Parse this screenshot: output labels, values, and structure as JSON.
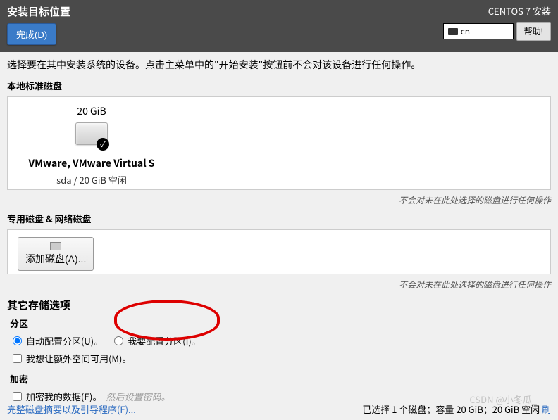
{
  "header": {
    "title": "安装目标位置",
    "done_button": "完成(D)",
    "installer_name": "CENTOS 7 安装",
    "lang": "cn",
    "help_button": "帮助!"
  },
  "instruction": "选择要在其中安装系统的设备。点击主菜单中的\"开始安装\"按钮前不会对该设备进行任何操作。",
  "local_disks": {
    "label": "本地标准磁盘",
    "disk": {
      "size": "20 GiB",
      "name": "VMware, VMware Virtual S",
      "info": "sda    /    20 GiB 空闲"
    },
    "note": "不会对未在此处选择的磁盘进行任何操作"
  },
  "special_disks": {
    "label": "专用磁盘 & 网络磁盘",
    "add_button": "添加磁盘(A)...",
    "note": "不会对未在此处选择的磁盘进行任何操作"
  },
  "other_storage": {
    "title": "其它存储选项",
    "partition": {
      "label": "分区",
      "auto": "自动配置分区(U)。",
      "manual": "我要配置分区(I)。",
      "extra_space": "我想让额外空间可用(M)。"
    },
    "encryption": {
      "label": "加密",
      "encrypt_data": "加密我的数据(E)。",
      "hint": "然后设置密码。"
    }
  },
  "footer": {
    "summary_link": "完整磁盘摘要以及引导程序(F)...",
    "status": "已选择 1 个磁盘；容量 20 GiB；20 GiB 空闲 ",
    "refresh": "刷"
  },
  "watermark": "CSDN @小冬瓜_"
}
